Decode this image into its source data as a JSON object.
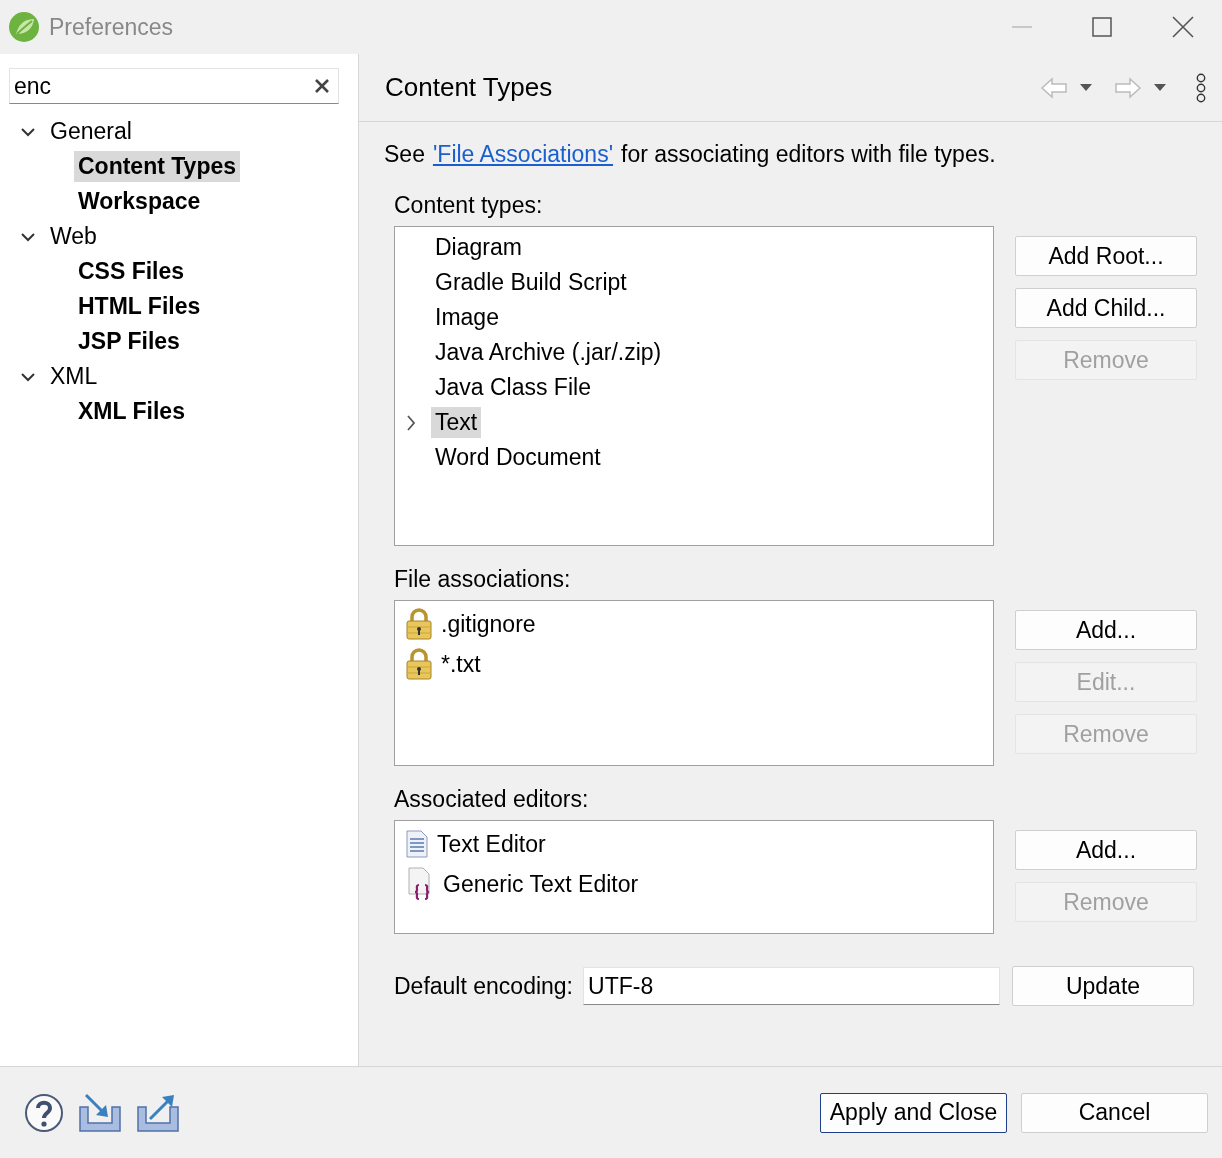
{
  "window": {
    "title": "Preferences"
  },
  "filter": {
    "value": "enc"
  },
  "tree": [
    {
      "label": "General",
      "expanded": true,
      "matched": false,
      "selected": false,
      "children": [
        {
          "label": "Content Types",
          "matched": true,
          "selected": true
        },
        {
          "label": "Workspace",
          "matched": true,
          "selected": false
        }
      ]
    },
    {
      "label": "Web",
      "expanded": true,
      "matched": false,
      "selected": false,
      "children": [
        {
          "label": "CSS Files",
          "matched": true,
          "selected": false
        },
        {
          "label": "HTML Files",
          "matched": true,
          "selected": false
        },
        {
          "label": "JSP Files",
          "matched": true,
          "selected": false
        }
      ]
    },
    {
      "label": "XML",
      "expanded": true,
      "matched": false,
      "selected": false,
      "children": [
        {
          "label": "XML Files",
          "matched": true,
          "selected": false
        }
      ]
    }
  ],
  "page": {
    "title": "Content Types",
    "intro": {
      "before": "See",
      "link": "'File Associations'",
      "after": "for associating editors with file types."
    },
    "sections": [
      {
        "label": "Content types:",
        "items": [
          {
            "label": "Diagram",
            "kind": "plain",
            "expandable": false,
            "selected": false
          },
          {
            "label": "Gradle Build Script",
            "kind": "plain",
            "expandable": false,
            "selected": false
          },
          {
            "label": "Image",
            "kind": "plain",
            "expandable": false,
            "selected": false
          },
          {
            "label": "Java Archive (.jar/.zip)",
            "kind": "plain",
            "expandable": false,
            "selected": false
          },
          {
            "label": "Java Class File",
            "kind": "plain",
            "expandable": false,
            "selected": false
          },
          {
            "label": "Text",
            "kind": "plain",
            "expandable": true,
            "selected": true
          },
          {
            "label": "Word Document",
            "kind": "plain",
            "expandable": false,
            "selected": false
          }
        ],
        "buttons": [
          {
            "label": "Add Root...",
            "disabled": false
          },
          {
            "label": "Add Child...",
            "disabled": false
          },
          {
            "label": "Remove",
            "disabled": true
          }
        ]
      },
      {
        "label": "File associations:",
        "items": [
          {
            "label": ".gitignore",
            "kind": "locked",
            "expandable": false,
            "selected": false
          },
          {
            "label": "*.txt",
            "kind": "locked",
            "expandable": false,
            "selected": false
          }
        ],
        "buttons": [
          {
            "label": "Add...",
            "disabled": false
          },
          {
            "label": "Edit...",
            "disabled": true
          },
          {
            "label": "Remove",
            "disabled": true
          }
        ]
      },
      {
        "label": "Associated editors:",
        "items": [
          {
            "label": "Text Editor",
            "kind": "editor",
            "expandable": false,
            "selected": false
          },
          {
            "label": "Generic Text Editor",
            "kind": "generic",
            "expandable": false,
            "selected": false
          }
        ],
        "buttons": [
          {
            "label": "Add...",
            "disabled": false
          },
          {
            "label": "Remove",
            "disabled": true
          }
        ]
      }
    ],
    "encoding": {
      "label": "Default encoding:",
      "value": "UTF-8",
      "button": "Update"
    }
  },
  "footer": {
    "buttons": [
      {
        "label": "Apply and Close",
        "focused": true
      },
      {
        "label": "Cancel",
        "focused": false
      }
    ]
  }
}
